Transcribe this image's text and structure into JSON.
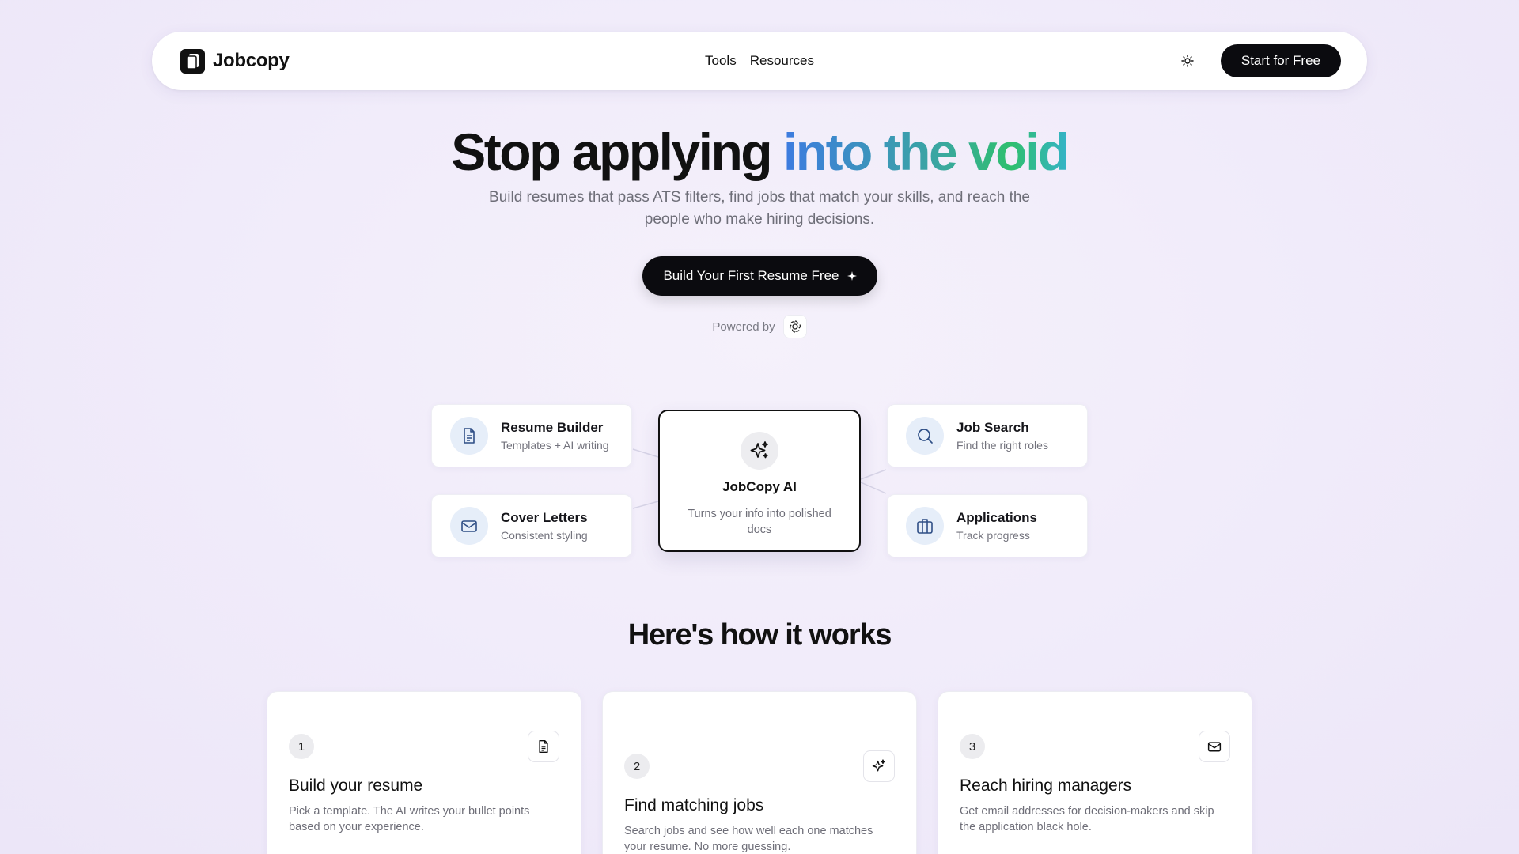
{
  "nav": {
    "brand": "Jobcopy",
    "links": [
      "Tools",
      "Resources"
    ],
    "cta": "Start for Free",
    "theme_icon": "sun-icon"
  },
  "hero": {
    "title_plain": "Stop applying ",
    "title_highlight": "into the void",
    "subtitle": "Build resumes that pass ATS filters, find jobs that match your skills, and reach the people who make hiring decisions.",
    "cta": "Build Your First Resume Free",
    "cta_icon": "sparkle-icon",
    "powered_by": "Powered by",
    "powered_icon": "openai-logo-icon"
  },
  "diagram": {
    "center": {
      "title": "JobCopy AI",
      "subtitle": "Turns your info into polished docs",
      "icon": "sparkles-icon"
    },
    "features": [
      {
        "title": "Resume Builder",
        "subtitle": "Templates + AI writing",
        "icon": "document-icon"
      },
      {
        "title": "Cover Letters",
        "subtitle": "Consistent styling",
        "icon": "mail-icon"
      },
      {
        "title": "Job Search",
        "subtitle": "Find the right roles",
        "icon": "search-icon"
      },
      {
        "title": "Applications",
        "subtitle": "Track progress",
        "icon": "briefcase-icon"
      }
    ]
  },
  "how": {
    "title": "Here's how it works",
    "steps": [
      {
        "number": "1",
        "title": "Build your resume",
        "description": "Pick a template. The AI writes your bullet points based on your experience.",
        "icon": "document-icon"
      },
      {
        "number": "2",
        "title": "Find matching jobs",
        "description": "Search jobs and see how well each one matches your resume. No more guessing.",
        "icon": "sparkles-icon"
      },
      {
        "number": "3",
        "title": "Reach hiring managers",
        "description": "Get email addresses for decision-makers and skip the application black hole.",
        "icon": "mail-icon"
      }
    ]
  },
  "colors": {
    "accent_dark": "#0b0b0f",
    "gradient_start": "#3d7be0",
    "gradient_end": "#2fbf6e",
    "icon_blue": "#2f4f86"
  }
}
